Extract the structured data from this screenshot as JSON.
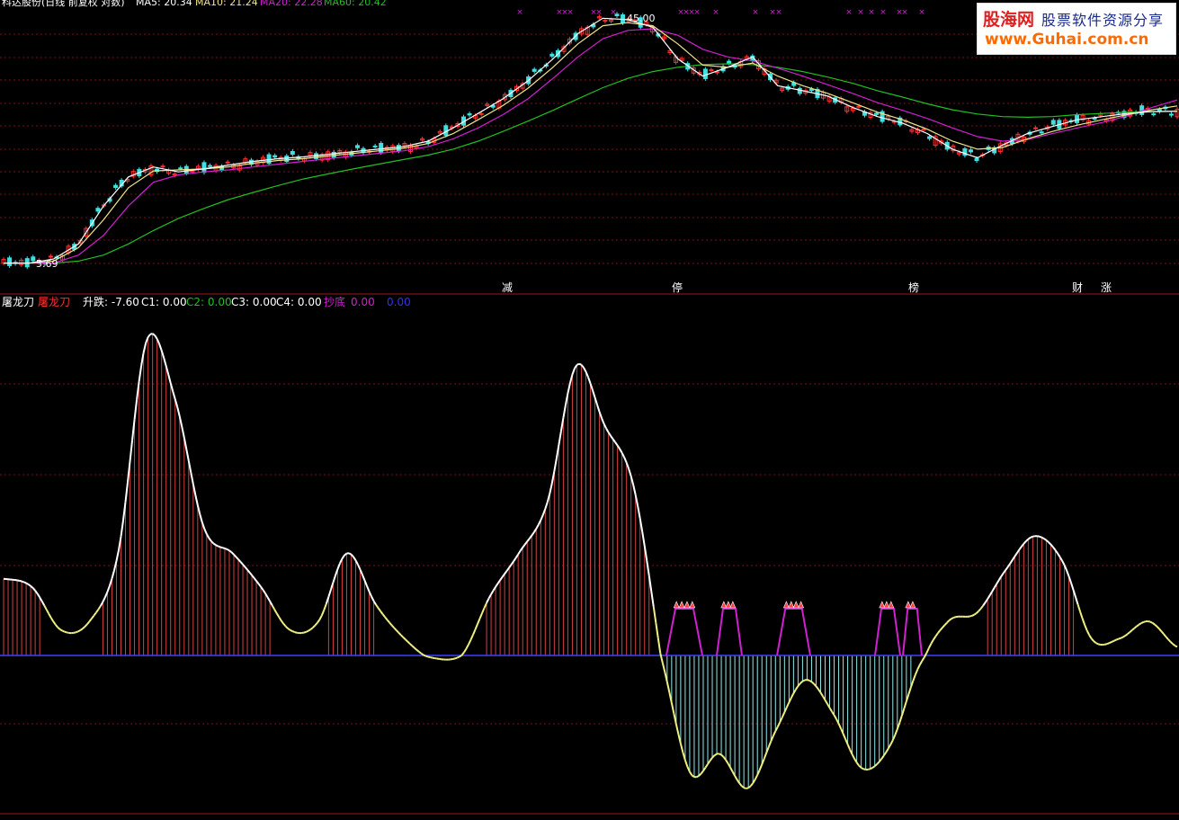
{
  "colors": {
    "background": "#000000",
    "divider": "#a01818",
    "grid": "#7a1010",
    "ma5": "#ffffff",
    "ma10": "#f0e68c",
    "ma20": "#d020d0",
    "ma60": "#20c020",
    "up_candle": "#ff3030",
    "down_candle": "#40e0e0",
    "tlb_positive_fill": "#d04040",
    "tlb_negative_fill": "#90e8e8",
    "tlb_line_up": "#ffffff",
    "tlb_line_down": "#f0f080",
    "chaodi": "#d020d0",
    "zero_line": "#4040ff",
    "label_minus": "#ff3030",
    "label_minus_green": "#20c020"
  },
  "header": {
    "title_prefix": "科达股份(日线 前复权 对数)",
    "ma5_label": "MA5: 20.34",
    "ma10_label": "MA10: 21.24",
    "ma20_label": "MA20: 22.28",
    "ma60_label": "MA60: 20.42"
  },
  "price_panel": {
    "high_label": "45.00",
    "low_label": "5.69",
    "event_labels": [
      "减",
      "停",
      "榜",
      "财",
      "涨"
    ],
    "x_mark": "×"
  },
  "indicator_header": {
    "name": "屠龙刀",
    "name2": "屠龙刀",
    "rise_fall": "升跌: -7.60",
    "c1": "C1: 0.00",
    "c2": "C2: 0.00",
    "c3": "C3: 0.00",
    "c4": "C4: 0.00",
    "chaodi_label": "抄底",
    "chaodi_value": "0.00",
    "blue_value": "0.00"
  },
  "logo": {
    "brand": "股海网",
    "slogan": "股票软件资源分享",
    "url": "www.Guhai.com.cn"
  },
  "chart_data": [
    {
      "type": "line",
      "title": "科达股份(日线 前复权 对数)",
      "series": [
        {
          "name": "MA5",
          "values": [
            6.0,
            6.0,
            6.2,
            7.0,
            9.5,
            12.0,
            13.0,
            12.5,
            12.8,
            13.2,
            13.6,
            13.9,
            14.1,
            14.4,
            14.7,
            15.0,
            15.3,
            16.0,
            17.8,
            20.0,
            22.5,
            26.0,
            31.0,
            38.0,
            43.0,
            42.5,
            40.0,
            31.0,
            27.0,
            29.0,
            31.5,
            25.0,
            24.0,
            23.0,
            21.0,
            19.5,
            18.5,
            17.0,
            15.0,
            14.0,
            15.5,
            17.0,
            18.0,
            19.0,
            19.5,
            20.0,
            20.3,
            20.34
          ]
        },
        {
          "name": "MA10",
          "values": [
            6.0,
            6.0,
            6.1,
            6.8,
            8.5,
            11.0,
            12.6,
            12.7,
            12.8,
            13.0,
            13.4,
            13.7,
            13.9,
            14.2,
            14.5,
            14.8,
            15.1,
            15.7,
            17.0,
            19.0,
            21.3,
            24.5,
            29.0,
            35.0,
            40.5,
            41.5,
            40.5,
            35.0,
            29.5,
            29.0,
            30.0,
            27.0,
            25.0,
            23.5,
            21.8,
            20.2,
            19.0,
            17.6,
            16.0,
            15.0,
            15.2,
            16.3,
            17.3,
            18.2,
            19.0,
            19.8,
            20.6,
            21.24
          ]
        },
        {
          "name": "MA20",
          "values": [
            6.0,
            6.0,
            6.0,
            6.4,
            7.5,
            9.5,
            11.5,
            12.2,
            12.5,
            12.7,
            13.0,
            13.3,
            13.6,
            13.9,
            14.2,
            14.5,
            14.8,
            15.3,
            16.3,
            17.8,
            19.8,
            22.5,
            26.5,
            31.5,
            36.5,
            39.0,
            39.5,
            37.5,
            33.5,
            31.5,
            30.5,
            28.8,
            27.0,
            25.2,
            23.5,
            21.8,
            20.5,
            19.2,
            17.8,
            16.6,
            16.0,
            16.2,
            17.0,
            17.8,
            18.6,
            19.6,
            21.0,
            22.28
          ]
        },
        {
          "name": "MA60",
          "values": [
            6.0,
            6.0,
            6.0,
            6.1,
            6.4,
            7.0,
            7.8,
            8.6,
            9.3,
            10.0,
            10.6,
            11.2,
            11.8,
            12.3,
            12.8,
            13.3,
            13.8,
            14.3,
            15.0,
            16.0,
            17.3,
            18.8,
            20.5,
            22.5,
            24.6,
            26.5,
            28.0,
            29.0,
            29.6,
            29.8,
            29.6,
            29.0,
            28.0,
            26.8,
            25.5,
            24.0,
            22.8,
            21.6,
            20.6,
            19.9,
            19.5,
            19.4,
            19.5,
            19.8,
            20.0,
            20.2,
            20.3,
            20.42
          ]
        }
      ],
      "ylim": [
        5.69,
        45.0
      ],
      "grid": true
    },
    {
      "type": "area",
      "title": "屠龙刀",
      "values": [
        90,
        80,
        30,
        40,
        120,
        370,
        300,
        150,
        120,
        80,
        30,
        40,
        120,
        60,
        20,
        -5,
        0,
        70,
        120,
        180,
        340,
        270,
        200,
        -10,
        -240,
        -200,
        -270,
        -150,
        -50,
        -120,
        -230,
        -180,
        -20,
        40,
        50,
        100,
        140,
        110,
        20,
        20,
        40,
        10
      ],
      "ylim": [
        -300,
        400
      ],
      "grid": true
    }
  ]
}
